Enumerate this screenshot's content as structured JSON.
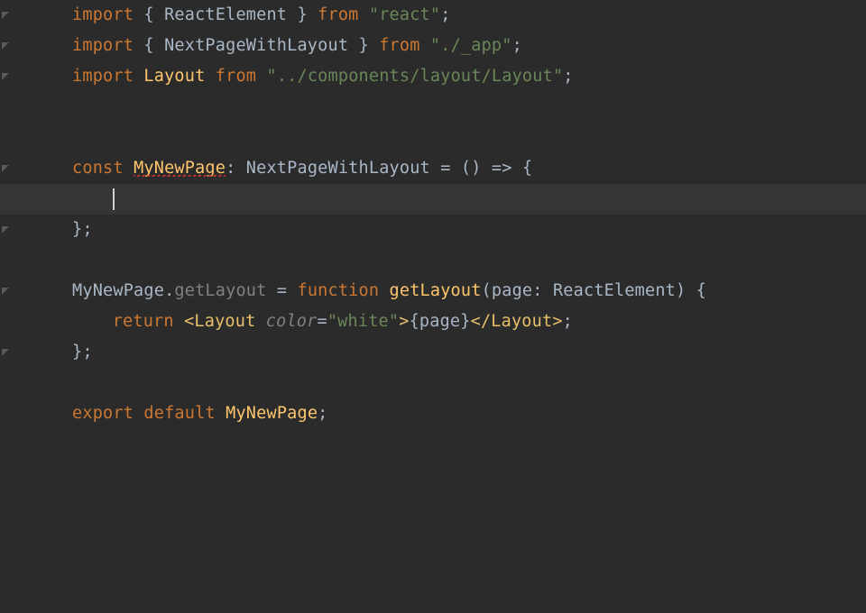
{
  "code": {
    "line1": {
      "kw_import": "import",
      "brace_open": " { ",
      "ReactElement": "ReactElement",
      "brace_close": " } ",
      "kw_from": "from ",
      "str": "\"react\"",
      "semi": ";"
    },
    "line2": {
      "kw_import": "import",
      "brace_open": " { ",
      "NextPageWithLayout": "NextPageWithLayout",
      "brace_close": " } ",
      "kw_from": "from ",
      "str": "\"./_app\"",
      "semi": ";"
    },
    "line3": {
      "kw_import": "import ",
      "Layout": "Layout",
      "sp": " ",
      "kw_from": "from ",
      "str": "\"../components/layout/Layout\"",
      "semi": ";"
    },
    "line6": {
      "kw_const": "const ",
      "MyNewPage": "MyNewPage",
      "colon": ": ",
      "type": "NextPageWithLayout",
      "eq": " = ",
      "parens": "()",
      "arrow": " => ",
      "brace": "{"
    },
    "line7": {
      "cursor_indent": "  "
    },
    "line8": {
      "close": "};"
    },
    "line10": {
      "MyNewPage": "MyNewPage",
      "dot": ".",
      "getLayout": "getLayout",
      "eq": " = ",
      "kw_function": "function ",
      "getLayoutFn": "getLayout",
      "open_paren": "(",
      "param": "page",
      "colon": ": ",
      "paramType": "ReactElement",
      "close_paren": ")",
      "sp": " ",
      "brace": "{"
    },
    "line11": {
      "kw_return": "  return ",
      "lt": "<",
      "Layout": "Layout",
      "sp": " ",
      "attr": "color",
      "eq": "=",
      "str": "\"white\"",
      "gt": ">",
      "expr_open": "{",
      "page": "page",
      "expr_close": "}",
      "lt2": "</",
      "Layout2": "Layout",
      "gt2": ">",
      "semi": ";"
    },
    "line12": {
      "close": "};"
    },
    "line14": {
      "kw_export": "export ",
      "kw_default": "default ",
      "MyNewPage": "MyNewPage",
      "semi": ";"
    }
  }
}
